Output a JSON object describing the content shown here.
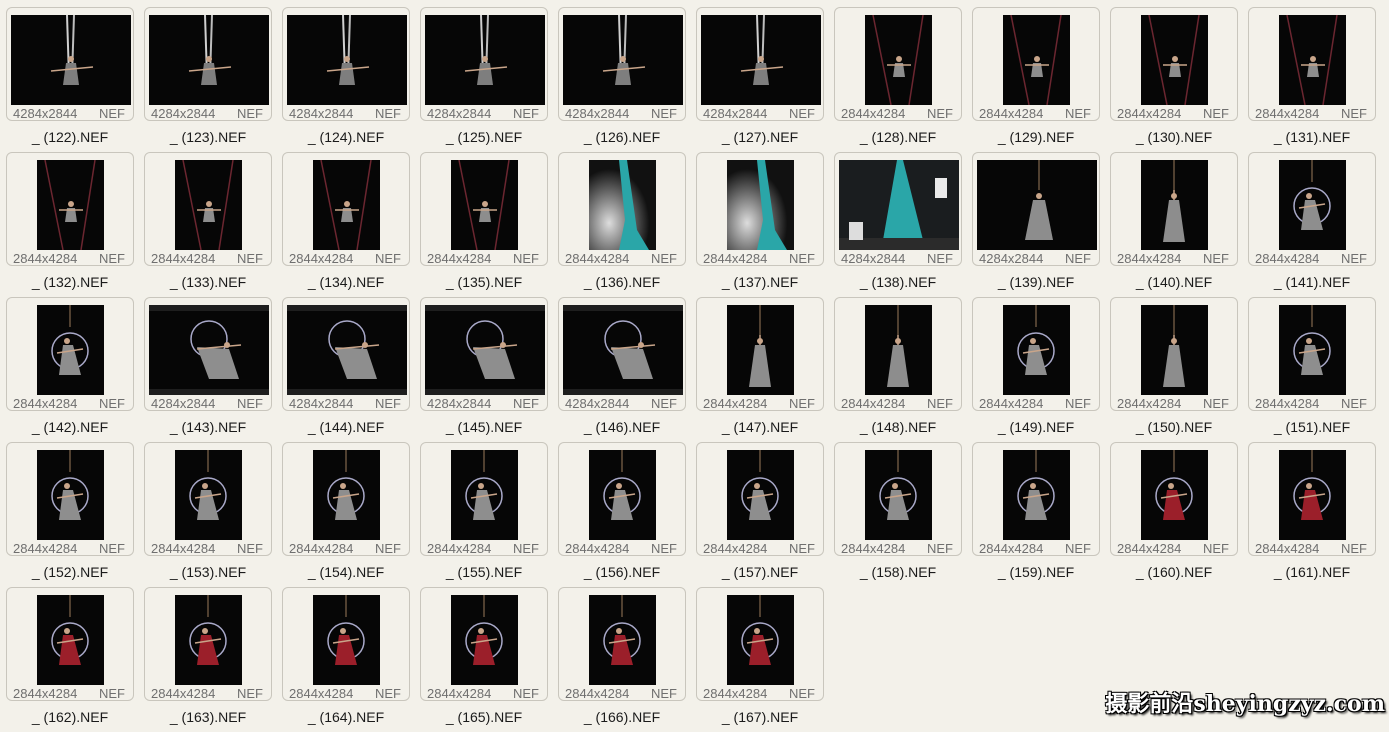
{
  "files": [
    {
      "name": "_ (122).NEF",
      "dims": "4284x2844",
      "ext": "NEF",
      "orientation": "landscape",
      "scene": "silks"
    },
    {
      "name": "_ (123).NEF",
      "dims": "4284x2844",
      "ext": "NEF",
      "orientation": "landscape",
      "scene": "silks"
    },
    {
      "name": "_ (124).NEF",
      "dims": "4284x2844",
      "ext": "NEF",
      "orientation": "landscape",
      "scene": "silks"
    },
    {
      "name": "_ (125).NEF",
      "dims": "4284x2844",
      "ext": "NEF",
      "orientation": "landscape",
      "scene": "silks"
    },
    {
      "name": "_ (126).NEF",
      "dims": "4284x2844",
      "ext": "NEF",
      "orientation": "landscape",
      "scene": "silks"
    },
    {
      "name": "_ (127).NEF",
      "dims": "4284x2844",
      "ext": "NEF",
      "orientation": "landscape",
      "scene": "silks"
    },
    {
      "name": "_ (128).NEF",
      "dims": "2844x4284",
      "ext": "NEF",
      "orientation": "portrait",
      "scene": "straps"
    },
    {
      "name": "_ (129).NEF",
      "dims": "2844x4284",
      "ext": "NEF",
      "orientation": "portrait",
      "scene": "straps"
    },
    {
      "name": "_ (130).NEF",
      "dims": "2844x4284",
      "ext": "NEF",
      "orientation": "portrait",
      "scene": "straps"
    },
    {
      "name": "_ (131).NEF",
      "dims": "2844x4284",
      "ext": "NEF",
      "orientation": "portrait",
      "scene": "straps"
    },
    {
      "name": "_ (132).NEF",
      "dims": "2844x4284",
      "ext": "NEF",
      "orientation": "portrait",
      "scene": "straps"
    },
    {
      "name": "_ (133).NEF",
      "dims": "2844x4284",
      "ext": "NEF",
      "orientation": "portrait",
      "scene": "straps"
    },
    {
      "name": "_ (134).NEF",
      "dims": "2844x4284",
      "ext": "NEF",
      "orientation": "portrait",
      "scene": "straps"
    },
    {
      "name": "_ (135).NEF",
      "dims": "2844x4284",
      "ext": "NEF",
      "orientation": "portrait",
      "scene": "straps"
    },
    {
      "name": "_ (136).NEF",
      "dims": "2844x4284",
      "ext": "NEF",
      "orientation": "portrait",
      "scene": "teal-smoke"
    },
    {
      "name": "_ (137).NEF",
      "dims": "2844x4284",
      "ext": "NEF",
      "orientation": "portrait",
      "scene": "teal-smoke"
    },
    {
      "name": "_ (138).NEF",
      "dims": "4284x2844",
      "ext": "NEF",
      "orientation": "landscape",
      "scene": "teal-studio"
    },
    {
      "name": "_ (139).NEF",
      "dims": "4284x2844",
      "ext": "NEF",
      "orientation": "landscape",
      "scene": "dancer"
    },
    {
      "name": "_ (140).NEF",
      "dims": "2844x4284",
      "ext": "NEF",
      "orientation": "portrait",
      "scene": "dancer"
    },
    {
      "name": "_ (141).NEF",
      "dims": "2844x4284",
      "ext": "NEF",
      "orientation": "portrait",
      "scene": "hoop"
    },
    {
      "name": "_ (142).NEF",
      "dims": "2844x4284",
      "ext": "NEF",
      "orientation": "portrait",
      "scene": "hoop"
    },
    {
      "name": "_ (143).NEF",
      "dims": "4284x2844",
      "ext": "NEF",
      "orientation": "landscape",
      "scene": "hoop"
    },
    {
      "name": "_ (144).NEF",
      "dims": "4284x2844",
      "ext": "NEF",
      "orientation": "landscape",
      "scene": "hoop"
    },
    {
      "name": "_ (145).NEF",
      "dims": "4284x2844",
      "ext": "NEF",
      "orientation": "landscape",
      "scene": "hoop"
    },
    {
      "name": "_ (146).NEF",
      "dims": "4284x2844",
      "ext": "NEF",
      "orientation": "landscape",
      "scene": "hoop"
    },
    {
      "name": "_ (147).NEF",
      "dims": "2844x4284",
      "ext": "NEF",
      "orientation": "portrait",
      "scene": "dancer"
    },
    {
      "name": "_ (148).NEF",
      "dims": "2844x4284",
      "ext": "NEF",
      "orientation": "portrait",
      "scene": "dancer"
    },
    {
      "name": "_ (149).NEF",
      "dims": "2844x4284",
      "ext": "NEF",
      "orientation": "portrait",
      "scene": "hoop"
    },
    {
      "name": "_ (150).NEF",
      "dims": "2844x4284",
      "ext": "NEF",
      "orientation": "portrait",
      "scene": "dancer"
    },
    {
      "name": "_ (151).NEF",
      "dims": "2844x4284",
      "ext": "NEF",
      "orientation": "portrait",
      "scene": "hoop"
    },
    {
      "name": "_ (152).NEF",
      "dims": "2844x4284",
      "ext": "NEF",
      "orientation": "portrait",
      "scene": "hoop"
    },
    {
      "name": "_ (153).NEF",
      "dims": "2844x4284",
      "ext": "NEF",
      "orientation": "portrait",
      "scene": "hoop"
    },
    {
      "name": "_ (154).NEF",
      "dims": "2844x4284",
      "ext": "NEF",
      "orientation": "portrait",
      "scene": "hoop"
    },
    {
      "name": "_ (155).NEF",
      "dims": "2844x4284",
      "ext": "NEF",
      "orientation": "portrait",
      "scene": "hoop"
    },
    {
      "name": "_ (156).NEF",
      "dims": "2844x4284",
      "ext": "NEF",
      "orientation": "portrait",
      "scene": "hoop"
    },
    {
      "name": "_ (157).NEF",
      "dims": "2844x4284",
      "ext": "NEF",
      "orientation": "portrait",
      "scene": "hoop"
    },
    {
      "name": "_ (158).NEF",
      "dims": "2844x4284",
      "ext": "NEF",
      "orientation": "portrait",
      "scene": "hoop"
    },
    {
      "name": "_ (159).NEF",
      "dims": "2844x4284",
      "ext": "NEF",
      "orientation": "portrait",
      "scene": "hoop"
    },
    {
      "name": "_ (160).NEF",
      "dims": "2844x4284",
      "ext": "NEF",
      "orientation": "portrait",
      "scene": "hoop-red"
    },
    {
      "name": "_ (161).NEF",
      "dims": "2844x4284",
      "ext": "NEF",
      "orientation": "portrait",
      "scene": "hoop-red"
    },
    {
      "name": "_ (162).NEF",
      "dims": "2844x4284",
      "ext": "NEF",
      "orientation": "portrait",
      "scene": "hoop-red"
    },
    {
      "name": "_ (163).NEF",
      "dims": "2844x4284",
      "ext": "NEF",
      "orientation": "portrait",
      "scene": "hoop-red"
    },
    {
      "name": "_ (164).NEF",
      "dims": "2844x4284",
      "ext": "NEF",
      "orientation": "portrait",
      "scene": "hoop-red"
    },
    {
      "name": "_ (165).NEF",
      "dims": "2844x4284",
      "ext": "NEF",
      "orientation": "portrait",
      "scene": "hoop-red"
    },
    {
      "name": "_ (166).NEF",
      "dims": "2844x4284",
      "ext": "NEF",
      "orientation": "portrait",
      "scene": "hoop-red"
    },
    {
      "name": "_ (167).NEF",
      "dims": "2844x4284",
      "ext": "NEF",
      "orientation": "portrait",
      "scene": "hoop-red"
    }
  ],
  "watermark": "摄影前沿sheyingzyz.com",
  "colors": {
    "background": "#f3f1ea",
    "card_border": "#c9c6bd",
    "thumb_bg": "#060606",
    "label_text": "#1b1b1b",
    "meta_text": "#6f6f6f",
    "teal": "#2aa6a8",
    "red_fabric": "#9b1f2a"
  }
}
